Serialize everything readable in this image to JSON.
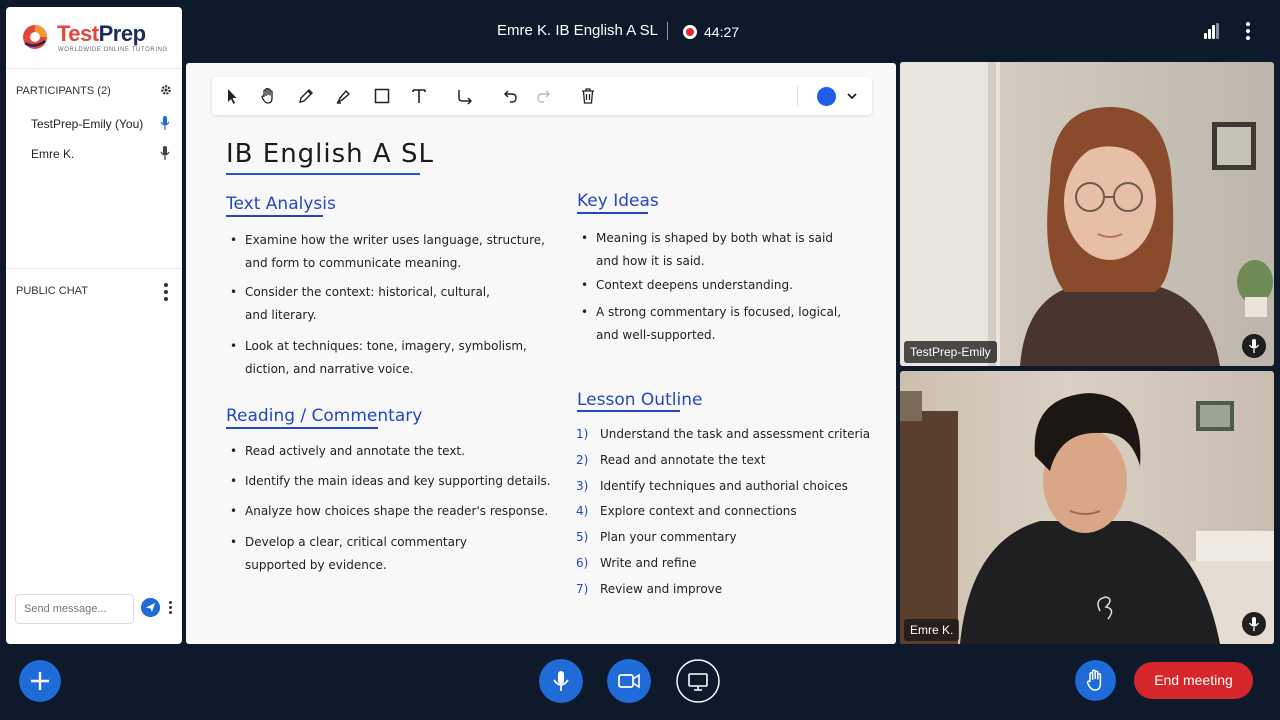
{
  "header": {
    "meeting_title": "Emre K. IB English A SL",
    "timer": "44:27",
    "recording_color": "#e0282b"
  },
  "sidebar": {
    "logo": {
      "name": "TestPrep",
      "name_part1": "Test",
      "name_part2": "Prep",
      "tagline": "WORLDWIDE ONLINE TUTORING"
    },
    "participants_heading": "PARTICIPANTS (2)",
    "participants": [
      {
        "name": "TestPrep-Emily (You)",
        "mic_icon": "mic-icon",
        "mic_color": "#1f6bd8"
      },
      {
        "name": "Emre K.",
        "mic_icon": "mic-icon",
        "mic_color": "#333333"
      }
    ],
    "chat_heading": "PUBLIC CHAT",
    "chat_placeholder": "Send message..."
  },
  "toolbar": {
    "tools": [
      "select-arrow-icon",
      "hand-pan-icon",
      "pencil-icon",
      "highlighter-icon",
      "rectangle-icon",
      "text-icon",
      "connector-icon",
      "undo-icon",
      "redo-icon",
      "trash-icon"
    ],
    "current_color": "#1d5de8"
  },
  "board": {
    "title": "IB English A SL",
    "text_analysis": {
      "heading": "Text Analysis",
      "bullets": [
        [
          "Examine how the writer uses language, structure,",
          "and form to communicate meaning."
        ],
        [
          "Consider the context: historical, cultural,",
          "and literary."
        ],
        [
          "Look at techniques: tone, imagery, symbolism,",
          "diction, and narrative voice."
        ]
      ]
    },
    "reading_commentary": {
      "heading": "Reading / Commentary",
      "bullets": [
        [
          "Read actively and annotate the text."
        ],
        [
          "Identify the main ideas and key supporting details."
        ],
        [
          "Analyze how choices shape the reader's response."
        ],
        [
          "Develop a clear, critical commentary",
          "supported by evidence."
        ]
      ]
    },
    "key_ideas": {
      "heading": "Key Ideas",
      "bullets": [
        [
          "Meaning is shaped by both what is said",
          "and how it is said."
        ],
        [
          "Context deepens understanding."
        ],
        [
          "A strong commentary is focused, logical,",
          "and well-supported."
        ]
      ]
    },
    "lesson_outline": {
      "heading": "Lesson Outline",
      "items": [
        {
          "n": "1)",
          "text": "Understand the task and assessment criteria"
        },
        {
          "n": "2)",
          "text": "Read and annotate the text"
        },
        {
          "n": "3)",
          "text": "Identify techniques and authorial choices"
        },
        {
          "n": "4)",
          "text": "Explore context and connections"
        },
        {
          "n": "5)",
          "text": "Plan your commentary"
        },
        {
          "n": "6)",
          "text": "Write and refine"
        },
        {
          "n": "7)",
          "text": "Review and improve"
        }
      ]
    }
  },
  "videos": [
    {
      "name": "TestPrep-Emily"
    },
    {
      "name": "Emre K."
    }
  ],
  "bottom_bar": {
    "end_meeting_label": "End meeting",
    "accent_color": "#1f6bd8",
    "end_color": "#d6262b"
  }
}
